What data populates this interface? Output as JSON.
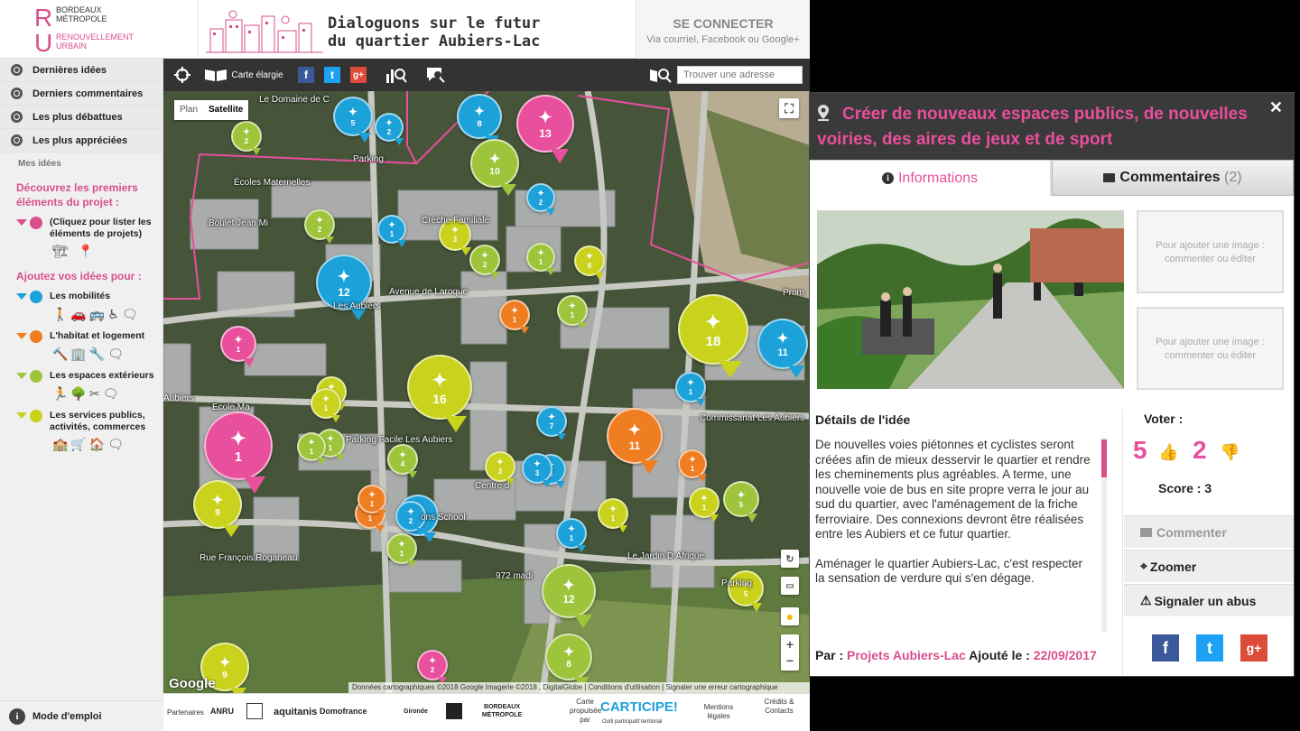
{
  "header": {
    "logo_line1": "BORDEAUX",
    "logo_line2": "MÉTROPOLE",
    "logo_line3": "RENOUVELLEMENT",
    "logo_line4": "URBAIN",
    "banner_line1": "Dialoguons sur le futur",
    "banner_line2": "du quartier Aubiers-Lac",
    "connect_title": "SE CONNECTER",
    "connect_sub": "Via courriel, Facebook ou Google+"
  },
  "sidebar": {
    "nav": [
      {
        "label": "Dernières idées"
      },
      {
        "label": "Derniers commentaires"
      },
      {
        "label": "Les plus débattues"
      },
      {
        "label": "Les plus appréciées"
      }
    ],
    "mes_idees": "Mes idées",
    "discover_title": "Découvrez les premiers éléments du projet :",
    "discover_item": "(Cliquez pour lister les éléments de projets)",
    "add_title": "Ajoutez vos idées pour :",
    "categories": [
      {
        "label": "Les mobilités",
        "color": "#1da1d9",
        "icons": "🚶🚗🚌♿🗨"
      },
      {
        "label": "L'habitat et logement",
        "color": "#ef7d22",
        "icons": "🔨🏢🔧🗨"
      },
      {
        "label": "Les espaces extérieurs",
        "color": "#9ec43b",
        "icons": "🏃🌳✂🗨"
      },
      {
        "label": "Les services publics, activités, commerces",
        "color": "#c9d21c",
        "icons": "🏫🛒🏠🗨"
      }
    ],
    "mode": "Mode d'emploi"
  },
  "toolbar": {
    "carte_label": "Carte élargie",
    "search_placeholder": "Trouver une adresse"
  },
  "map": {
    "plan": "Plan",
    "satellite": "Satellite",
    "labels": [
      {
        "text": "Le Domaine de C"
      },
      {
        "text": "Parking"
      },
      {
        "text": "Écoles Maternelles"
      },
      {
        "text": "Boulet Jean Mi"
      },
      {
        "text": "Crèche Familiale"
      },
      {
        "text": "Avenue de Laroque"
      },
      {
        "text": "Les Aubiers"
      },
      {
        "text": "Parking Facile Les Aubiers"
      },
      {
        "text": "Centre d"
      },
      {
        "text": "Ecole Ma"
      },
      {
        "text": "Aubiers"
      },
      {
        "text": "Commissariat Les Aubiers"
      },
      {
        "text": "Rue François Roganeau"
      },
      {
        "text": "Le Jardin D Afrique"
      },
      {
        "text": "972 madi"
      },
      {
        "text": "Parking"
      },
      {
        "text": "Prom"
      },
      {
        "text": "ons School"
      }
    ],
    "markers": [
      {
        "n": "5",
        "c": "#1da1d9"
      },
      {
        "n": "2",
        "c": "#9ec43b"
      },
      {
        "n": "8",
        "c": "#1da1d9"
      },
      {
        "n": "13",
        "c": "#e84f9c"
      },
      {
        "n": "10",
        "c": "#9ec43b"
      },
      {
        "n": "12",
        "c": "#1da1d9"
      },
      {
        "n": "16",
        "c": "#c9d21c"
      },
      {
        "n": "18",
        "c": "#c9d21c"
      },
      {
        "n": "11",
        "c": "#1da1d9"
      },
      {
        "n": "1",
        "c": "#e84f9c"
      },
      {
        "n": "9",
        "c": "#c9d21c"
      },
      {
        "n": "11",
        "c": "#ef7d22"
      },
      {
        "n": "12",
        "c": "#9ec43b"
      },
      {
        "n": "5",
        "c": "#9ec43b"
      },
      {
        "n": "9",
        "c": "#c9d21c"
      },
      {
        "n": "8",
        "c": "#9ec43b"
      },
      {
        "n": "2",
        "c": "#e84f9c"
      },
      {
        "n": "6",
        "c": "#1da1d9"
      },
      {
        "n": "4",
        "c": "#9ec43b"
      },
      {
        "n": "3",
        "c": "#1da1d9"
      },
      {
        "n": "7",
        "c": "#1da1d9"
      },
      {
        "n": "2",
        "c": "#c9d21c"
      },
      {
        "n": "1",
        "c": "#ef7d22"
      },
      {
        "n": "2",
        "c": "#1da1d9"
      },
      {
        "n": "1",
        "c": "#1da1d9"
      },
      {
        "n": "6",
        "c": "#c9d21c"
      },
      {
        "n": "3",
        "c": "#c9d21c"
      },
      {
        "n": "1",
        "c": "#1da1d9"
      },
      {
        "n": "1",
        "c": "#c9d21c"
      },
      {
        "n": "1",
        "c": "#ef7d22"
      },
      {
        "n": "1",
        "c": "#9ec43b"
      },
      {
        "n": "1",
        "c": "#e84f9c"
      },
      {
        "n": "2",
        "c": "#9ec43b"
      },
      {
        "n": "1",
        "c": "#c9d21c"
      },
      {
        "n": "5",
        "c": "#c9d21c"
      },
      {
        "n": "1",
        "c": "#9ec43b"
      },
      {
        "n": "1",
        "c": "#9ec43b"
      },
      {
        "n": "1",
        "c": "#ef7d22"
      },
      {
        "n": "1",
        "c": "#1da1d9"
      },
      {
        "n": "1",
        "c": "#9ec43b"
      },
      {
        "n": "1",
        "c": "#c9d21c"
      },
      {
        "n": "2",
        "c": "#9ec43b"
      },
      {
        "n": "2",
        "c": "#1da1d9"
      },
      {
        "n": "3",
        "c": "#1da1d9"
      },
      {
        "n": "2",
        "c": "#1da1d9"
      },
      {
        "n": "1",
        "c": "#9ec43b"
      },
      {
        "n": "1",
        "c": "#ef7d22"
      },
      {
        "n": "1",
        "c": "#c9d21c"
      }
    ],
    "google": "Google",
    "attribution": "Données cartographiques ©2018 Google Imagerie ©2018 , DigitalGlobe | Conditions d'utilisation | Signaler une erreur cartographique"
  },
  "footer": {
    "partenaires": "Partenaires",
    "anru": "ANRU",
    "aquitanis": "aquitanis",
    "domofrance": "Domofrance",
    "gironde": "Gironde",
    "bm": "BORDEAUX MÉTROPOLE",
    "carte_propulsee": "Carte propulsée par",
    "carticipe": "CARTICIPE!",
    "carticipe_sub": "Outil participatif territorial",
    "mentions": "Mentions légales",
    "credits": "Crédits & Contacts"
  },
  "panel": {
    "title": "Créer de nouveaux espaces publics, de nouvelles voiries, des aires de jeux et de sport",
    "tab_info": "Informations",
    "tab_comments": "Commentaires",
    "comments_count": "(2)",
    "placeholder_img": "Pour ajouter une image : commenter ou éditer",
    "details_title": "Détails de l'idée",
    "desc_p1": "De nouvelles voies piétonnes et cyclistes seront créées afin de mieux desservir le quartier et rendre les cheminements plus agréables. A terme, une nouvelle voie de bus en site propre verra le jour au sud du quartier, avec l'aménagement de la friche ferroviaire. Des connexions devront être réalisées entre les Aubiers et ce futur quartier.",
    "desc_p2": "Aménager le quartier Aubiers-Lac, c'est respecter la sensation de verdure qui s'en dégage.",
    "par_label": "Par :",
    "author": "Projets Aubiers-Lac",
    "added_label": "Ajouté le :",
    "date": "22/09/2017",
    "voter_label": "Voter :",
    "votes_up": "5",
    "votes_down": "2",
    "score": "Score : 3",
    "btn_comment": "Commenter",
    "btn_zoom": "Zoomer",
    "btn_report": "Signaler un abus",
    "close": "✕"
  }
}
